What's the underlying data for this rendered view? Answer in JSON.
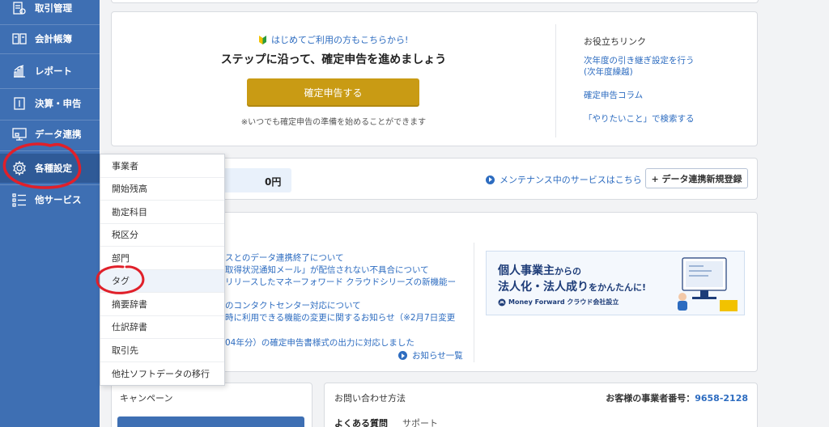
{
  "sidebar": {
    "items": [
      {
        "label": "取引管理",
        "icon": "list-icon"
      },
      {
        "label": "会計帳簿",
        "icon": "book-icon"
      },
      {
        "label": "レポート",
        "icon": "chart-icon"
      },
      {
        "label": "決算・申告",
        "icon": "document-icon"
      },
      {
        "label": "データ連携",
        "icon": "monitor-icon"
      },
      {
        "label": "各種設定",
        "icon": "gear-icon"
      },
      {
        "label": "他サービス",
        "icon": "menu-list-icon"
      }
    ]
  },
  "hero": {
    "hint": "はじめてご利用の方もこちらから!",
    "title": "ステップに沿って、確定申告を進めましょう",
    "button": "確定申告する",
    "note": "※いつでも確定申告の準備を始めることができます"
  },
  "useful_links": {
    "title": "お役立ちリンク",
    "items": [
      "次年度の引き継ぎ設定を行う",
      "(次年度繰越)",
      "確定申告コラム",
      "「やりたいこと」で検索する"
    ]
  },
  "balance": {
    "value": "0円"
  },
  "maintenance": {
    "label": "メンテナンス中のサービスはこちら"
  },
  "data_link_button": {
    "label": "+ データ連携新規登録"
  },
  "news": {
    "lines": [
      "スとのデータ連携終了について",
      "取得状況通知メール」が配信されない不具合について",
      "リリースしたマネーフォワード クラウドシリーズの新機能ー",
      "のコンタクトセンター対応について",
      "時に利用できる機能の変更に関するお知らせ（※2月7日変更",
      "04年分）の確定申告書様式の出力に対応しました"
    ],
    "more": "お知らせ一覧"
  },
  "banner": {
    "line1_a": "個人事業主",
    "line1_b": "からの",
    "line2_a": "法人化・法人成り",
    "line2_b": "をかんたんに!",
    "logo": "Money Forward クラウド会社設立"
  },
  "campaign": {
    "title": "キャンペーン"
  },
  "contact": {
    "title": "お問い合わせ方法",
    "business_label": "お客様の事業者番号：",
    "business_number": "9658-2128",
    "tabs": [
      "よくある質問",
      "サポート"
    ]
  },
  "settings_menu": {
    "items": [
      "事業者",
      "開始残高",
      "勘定科目",
      "税区分",
      "部門",
      "タグ",
      "摘要辞書",
      "仕訳辞書",
      "取引先",
      "他社ソフトデータの移行"
    ]
  },
  "colors": {
    "sidebar": "#3e6fb3",
    "primary_button": "#c99b14",
    "link": "#2d6cc0",
    "annotation": "#e0202a"
  }
}
